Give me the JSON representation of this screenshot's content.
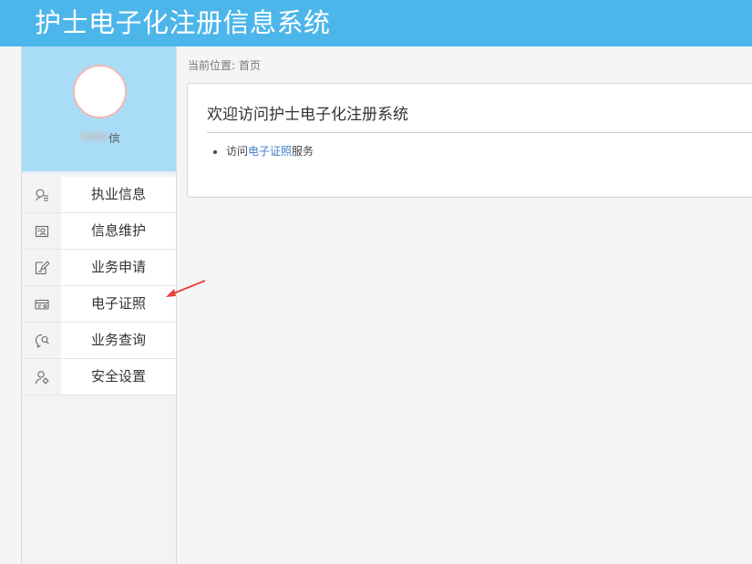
{
  "header": {
    "title": "护士电子化注册信息系统"
  },
  "profile": {
    "username_visible": "信"
  },
  "sidebar": {
    "items": [
      {
        "label": "执业信息",
        "icon": "practice-info-icon"
      },
      {
        "label": "信息维护",
        "icon": "id-card-icon"
      },
      {
        "label": "业务申请",
        "icon": "edit-form-icon"
      },
      {
        "label": "电子证照",
        "icon": "e-license-icon"
      },
      {
        "label": "业务查询",
        "icon": "query-icon"
      },
      {
        "label": "安全设置",
        "icon": "security-user-icon"
      }
    ]
  },
  "breadcrumb": {
    "text": "当前位置: 首页"
  },
  "welcome": {
    "title": "欢迎访问护士电子化注册系统",
    "line_prefix": "访问",
    "line_link": "电子证照",
    "line_suffix": "服务"
  },
  "colors": {
    "header": "#4cb6ea",
    "profile_bg": "#a9dcf7",
    "link": "#3d7ec8",
    "annotation_arrow": "#e8423a"
  }
}
